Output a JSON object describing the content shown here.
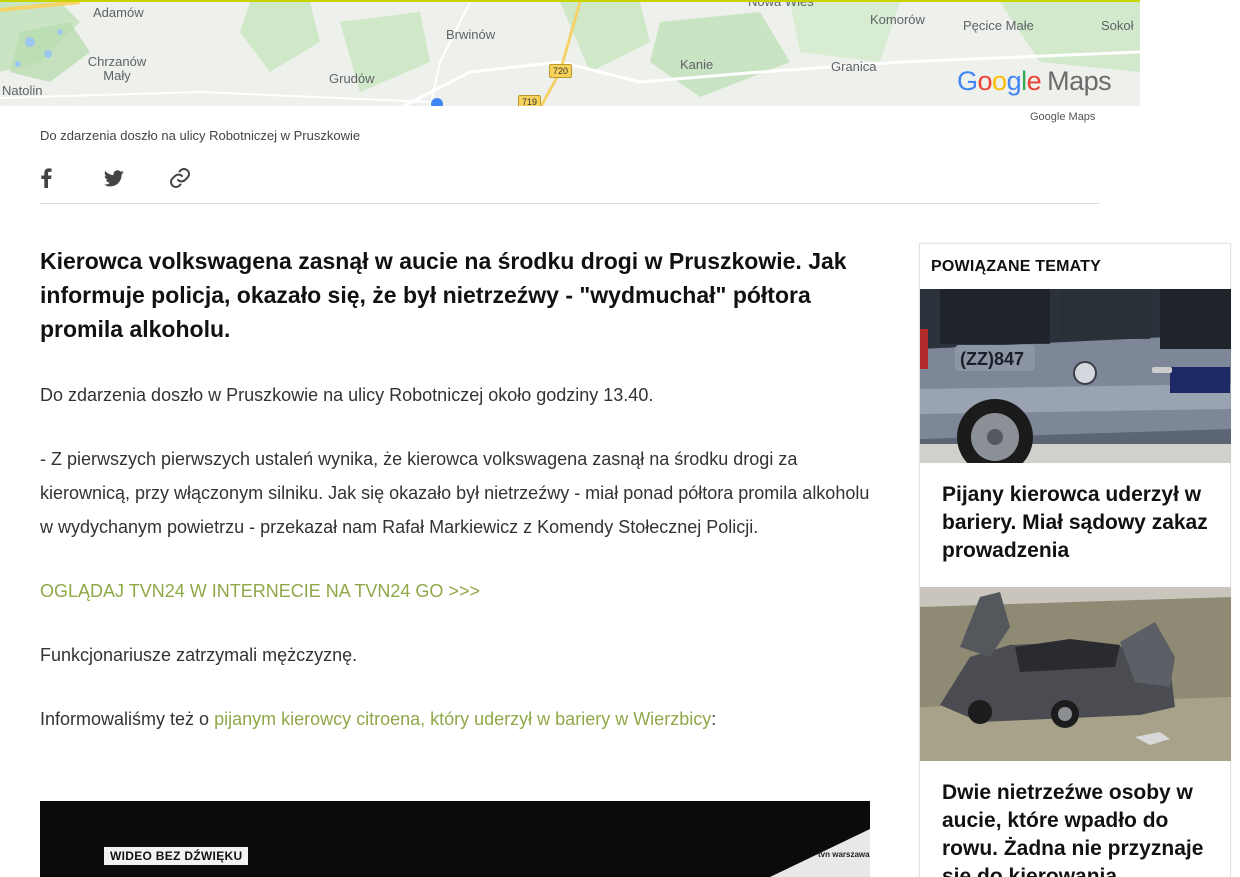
{
  "map": {
    "places": [
      {
        "name": "Adamów"
      },
      {
        "name": "Chrzanów Mały"
      },
      {
        "name": "Natolin"
      },
      {
        "name": "Brwinów"
      },
      {
        "name": "Grudów"
      },
      {
        "name": "Kanie"
      },
      {
        "name": "Komorów"
      },
      {
        "name": "Granica"
      },
      {
        "name": "Pęcice Małe"
      },
      {
        "name": "Sokoł"
      },
      {
        "name": "Nowa Wieś"
      }
    ],
    "roads": [
      "720",
      "719"
    ],
    "logo": {
      "google": "Google",
      "maps": "Maps"
    },
    "credit": "Google Maps"
  },
  "caption": "Do zdarzenia doszło na ulicy Robotniczej w Pruszkowie",
  "share": {
    "facebook": "facebook-icon",
    "twitter": "twitter-icon",
    "link": "link-icon"
  },
  "article": {
    "lead": "Kierowca volkswagena zasnął w aucie na środku drogi w Pruszkowie. Jak informuje policja, okazało się, że był nietrzeźwy - \"wydmuchał\" półtora promila alkoholu.",
    "p1": "Do zdarzenia doszło w Pruszkowie na ulicy Robotniczej około godziny 13.40.",
    "p2": "- Z pierwszych pierwszych ustaleń wynika, że kierowca volkswagena zasnął na środku drogi za kierownicą, przy włączonym silniku. Jak się okazało był nietrzeźwy - miał ponad półtora promila alkoholu w wydychanym powietrzu - przekazał nam Rafał Markiewicz z Komendy Stołecznej Policji.",
    "promo_link": "OGLĄDAJ TVN24 W INTERNECIE NA TVN24 GO >>>",
    "p3": "Funkcjonariusze zatrzymali mężczyznę.",
    "p4_prefix": "Informowaliśmy też o ",
    "p4_link": "pijanym kierowcy citroena, który uderzył w bariery w Wierzbicy",
    "p4_suffix": ":"
  },
  "video": {
    "badge": "WIDEO BEZ DŹWIĘKU",
    "brand": "tvn warszawa"
  },
  "sidebar": {
    "title": "POWIĄZANE TEMATY",
    "cards": [
      {
        "title": "Pijany kierowca uderzył w bariery. Miał sądowy zakaz prowadzenia",
        "img_text": "(ZZ)847"
      },
      {
        "title": "Dwie nietrzeźwe osoby w aucie, które wpadło do rowu. Żadna nie przyznaje się do kierowania"
      }
    ]
  },
  "colors": {
    "accent": "#8fa848",
    "map_top": "#c8d400"
  }
}
